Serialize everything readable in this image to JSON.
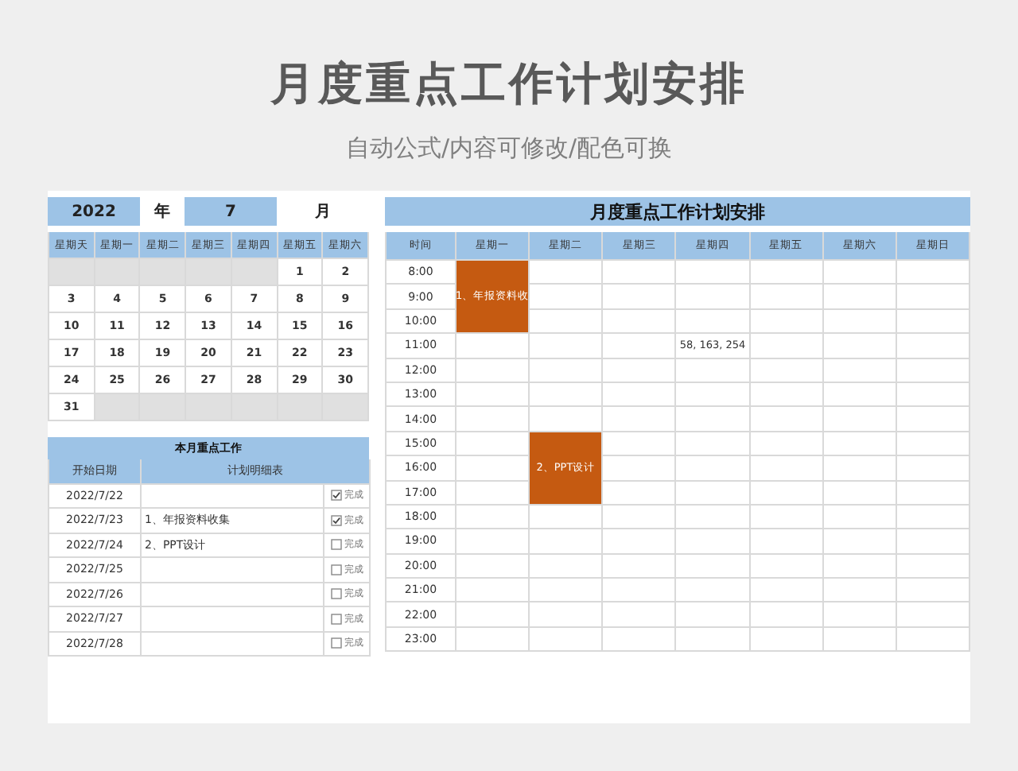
{
  "title": "月度重点工作计划安排",
  "subtitle": "自动公式/内容可修改/配色可换",
  "calendar": {
    "year": "2022",
    "year_label": "年",
    "month": "7",
    "month_label": "月",
    "weekdays": [
      "星期天",
      "星期一",
      "星期二",
      "星期三",
      "星期四",
      "星期五",
      "星期六"
    ],
    "weeks": [
      [
        {
          "kind": "blank"
        },
        {
          "kind": "blank"
        },
        {
          "kind": "blank"
        },
        {
          "kind": "blank"
        },
        {
          "kind": "blank"
        },
        {
          "kind": "day",
          "text": "1"
        },
        {
          "kind": "day",
          "text": "2"
        }
      ],
      [
        {
          "kind": "day",
          "text": "3"
        },
        {
          "kind": "day",
          "text": "4"
        },
        {
          "kind": "day",
          "text": "5"
        },
        {
          "kind": "day",
          "text": "6"
        },
        {
          "kind": "day",
          "text": "7"
        },
        {
          "kind": "day",
          "text": "8"
        },
        {
          "kind": "day",
          "text": "9"
        }
      ],
      [
        {
          "kind": "day",
          "text": "10"
        },
        {
          "kind": "day",
          "text": "11"
        },
        {
          "kind": "day",
          "text": "12"
        },
        {
          "kind": "day",
          "text": "13"
        },
        {
          "kind": "day",
          "text": "14"
        },
        {
          "kind": "day",
          "text": "15"
        },
        {
          "kind": "day",
          "text": "16"
        }
      ],
      [
        {
          "kind": "day",
          "text": "17"
        },
        {
          "kind": "day",
          "text": "18"
        },
        {
          "kind": "day",
          "text": "19"
        },
        {
          "kind": "day",
          "text": "20"
        },
        {
          "kind": "day",
          "text": "21"
        },
        {
          "kind": "day",
          "text": "22"
        },
        {
          "kind": "day",
          "text": "23"
        }
      ],
      [
        {
          "kind": "day",
          "text": "24"
        },
        {
          "kind": "day",
          "text": "25"
        },
        {
          "kind": "day",
          "text": "26"
        },
        {
          "kind": "day",
          "text": "27"
        },
        {
          "kind": "day",
          "text": "28"
        },
        {
          "kind": "day",
          "text": "29"
        },
        {
          "kind": "day",
          "text": "30"
        }
      ],
      [
        {
          "kind": "day",
          "text": "31"
        },
        {
          "kind": "blank"
        },
        {
          "kind": "blank"
        },
        {
          "kind": "blank"
        },
        {
          "kind": "blank"
        },
        {
          "kind": "blank"
        },
        {
          "kind": "blank"
        }
      ]
    ]
  },
  "tasks": {
    "title": "本月重点工作",
    "columns": [
      "开始日期",
      "计划明细表"
    ],
    "rows": [
      {
        "date": "2022/7/22",
        "done": true,
        "status": "完成"
      },
      {
        "date": "2022/7/23",
        "task": "1、年报资料收集",
        "done": true,
        "status": "完成"
      },
      {
        "date": "2022/7/24",
        "task": "2、PPT设计",
        "done": false,
        "status": "完成"
      },
      {
        "date": "2022/7/25",
        "done": false,
        "status": "完成"
      },
      {
        "date": "2022/7/26",
        "done": false,
        "status": "完成"
      },
      {
        "date": "2022/7/27",
        "done": false,
        "status": "完成"
      },
      {
        "date": "2022/7/28",
        "done": false,
        "status": "完成"
      }
    ]
  },
  "schedule": {
    "title": "月度重点工作计划安排",
    "columns": [
      "时间",
      "星期一",
      "星期二",
      "星期三",
      "星期四",
      "星期五",
      "星期六",
      "星期日"
    ],
    "rows": [
      {
        "cells": [
          {
            "kind": "time",
            "text": "8:00"
          },
          {
            "kind": "event",
            "text": "1、年报资料收"
          },
          {
            "kind": "empty"
          },
          {
            "kind": "empty"
          },
          {
            "kind": "empty"
          },
          {
            "kind": "empty"
          },
          {
            "kind": "empty"
          },
          {
            "kind": "empty"
          }
        ]
      },
      {
        "cells": [
          {
            "kind": "time",
            "text": "9:00"
          },
          {
            "kind": "continued"
          },
          {
            "kind": "empty"
          },
          {
            "kind": "empty"
          },
          {
            "kind": "empty"
          },
          {
            "kind": "empty"
          },
          {
            "kind": "empty"
          },
          {
            "kind": "empty"
          }
        ]
      },
      {
        "cells": [
          {
            "kind": "time",
            "text": "10:00"
          },
          {
            "kind": "continued"
          },
          {
            "kind": "empty"
          },
          {
            "kind": "empty"
          },
          {
            "kind": "empty"
          },
          {
            "kind": "empty"
          },
          {
            "kind": "empty"
          },
          {
            "kind": "empty"
          }
        ]
      },
      {
        "cells": [
          {
            "kind": "time",
            "text": "11:00"
          },
          {
            "kind": "empty"
          },
          {
            "kind": "empty"
          },
          {
            "kind": "empty"
          },
          {
            "kind": "text",
            "text": "58, 163, 254"
          },
          {
            "kind": "empty"
          },
          {
            "kind": "empty"
          },
          {
            "kind": "empty"
          }
        ]
      },
      {
        "cells": [
          {
            "kind": "time",
            "text": "12:00"
          },
          {
            "kind": "empty"
          },
          {
            "kind": "empty"
          },
          {
            "kind": "empty"
          },
          {
            "kind": "empty"
          },
          {
            "kind": "empty"
          },
          {
            "kind": "empty"
          },
          {
            "kind": "empty"
          }
        ]
      },
      {
        "cells": [
          {
            "kind": "time",
            "text": "13:00"
          },
          {
            "kind": "empty"
          },
          {
            "kind": "empty"
          },
          {
            "kind": "empty"
          },
          {
            "kind": "empty"
          },
          {
            "kind": "empty"
          },
          {
            "kind": "empty"
          },
          {
            "kind": "empty"
          }
        ]
      },
      {
        "cells": [
          {
            "kind": "time",
            "text": "14:00"
          },
          {
            "kind": "empty"
          },
          {
            "kind": "empty"
          },
          {
            "kind": "empty"
          },
          {
            "kind": "empty"
          },
          {
            "kind": "empty"
          },
          {
            "kind": "empty"
          },
          {
            "kind": "empty"
          }
        ]
      },
      {
        "cells": [
          {
            "kind": "time",
            "text": "15:00"
          },
          {
            "kind": "empty"
          },
          {
            "kind": "event",
            "text": "2、PPT设计"
          },
          {
            "kind": "empty"
          },
          {
            "kind": "empty"
          },
          {
            "kind": "empty"
          },
          {
            "kind": "empty"
          },
          {
            "kind": "empty"
          }
        ]
      },
      {
        "cells": [
          {
            "kind": "time",
            "text": "16:00"
          },
          {
            "kind": "empty"
          },
          {
            "kind": "continued"
          },
          {
            "kind": "empty"
          },
          {
            "kind": "empty"
          },
          {
            "kind": "empty"
          },
          {
            "kind": "empty"
          },
          {
            "kind": "empty"
          }
        ]
      },
      {
        "cells": [
          {
            "kind": "time",
            "text": "17:00"
          },
          {
            "kind": "empty"
          },
          {
            "kind": "continued"
          },
          {
            "kind": "empty"
          },
          {
            "kind": "empty"
          },
          {
            "kind": "empty"
          },
          {
            "kind": "empty"
          },
          {
            "kind": "empty"
          }
        ]
      },
      {
        "cells": [
          {
            "kind": "time",
            "text": "18:00"
          },
          {
            "kind": "empty"
          },
          {
            "kind": "empty"
          },
          {
            "kind": "empty"
          },
          {
            "kind": "empty"
          },
          {
            "kind": "empty"
          },
          {
            "kind": "empty"
          },
          {
            "kind": "empty"
          }
        ]
      },
      {
        "cells": [
          {
            "kind": "time",
            "text": "19:00"
          },
          {
            "kind": "empty"
          },
          {
            "kind": "empty"
          },
          {
            "kind": "empty"
          },
          {
            "kind": "empty"
          },
          {
            "kind": "empty"
          },
          {
            "kind": "empty"
          },
          {
            "kind": "empty"
          }
        ]
      },
      {
        "cells": [
          {
            "kind": "time",
            "text": "20:00"
          },
          {
            "kind": "empty"
          },
          {
            "kind": "empty"
          },
          {
            "kind": "empty"
          },
          {
            "kind": "empty"
          },
          {
            "kind": "empty"
          },
          {
            "kind": "empty"
          },
          {
            "kind": "empty"
          }
        ]
      },
      {
        "cells": [
          {
            "kind": "time",
            "text": "21:00"
          },
          {
            "kind": "empty"
          },
          {
            "kind": "empty"
          },
          {
            "kind": "empty"
          },
          {
            "kind": "empty"
          },
          {
            "kind": "empty"
          },
          {
            "kind": "empty"
          },
          {
            "kind": "empty"
          }
        ]
      },
      {
        "cells": [
          {
            "kind": "time",
            "text": "22:00"
          },
          {
            "kind": "empty"
          },
          {
            "kind": "empty"
          },
          {
            "kind": "empty"
          },
          {
            "kind": "empty"
          },
          {
            "kind": "empty"
          },
          {
            "kind": "empty"
          },
          {
            "kind": "empty"
          }
        ]
      },
      {
        "cells": [
          {
            "kind": "time",
            "text": "23:00"
          },
          {
            "kind": "empty"
          },
          {
            "kind": "empty"
          },
          {
            "kind": "empty"
          },
          {
            "kind": "empty"
          },
          {
            "kind": "empty"
          },
          {
            "kind": "empty"
          },
          {
            "kind": "empty"
          }
        ]
      }
    ]
  }
}
